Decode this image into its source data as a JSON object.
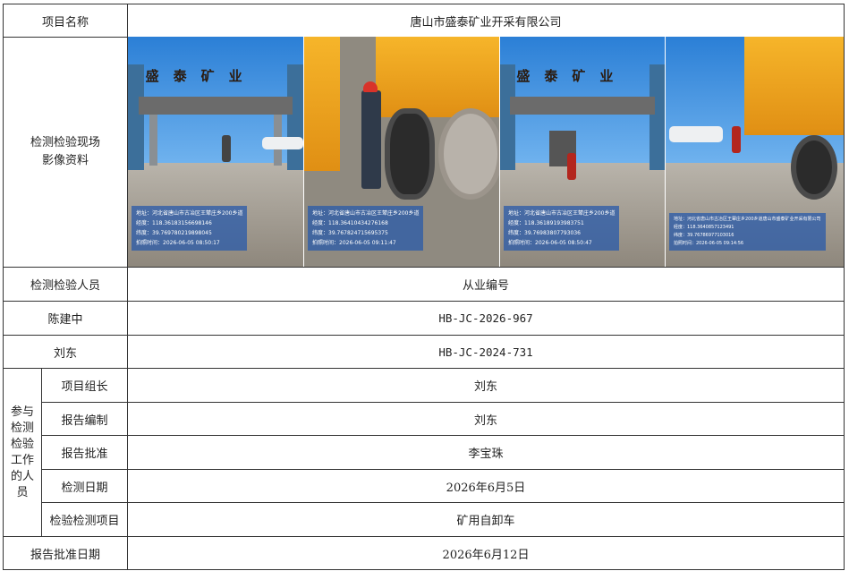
{
  "rows": {
    "project_name_label": "项目名称",
    "project_name_value": "唐山市盛泰矿业开采有限公司",
    "media_label_line1": "检测检验现场",
    "media_label_line2": "影像资料",
    "inspector_label": "检测检验人员",
    "cert_label": "从业编号",
    "inspector1_name": "陈建中",
    "inspector1_cert": "HB-JC-2026-967",
    "inspector2_name": "刘东",
    "inspector2_cert": "HB-JC-2024-731",
    "group_label": "参与检测检验工作的人员",
    "team_leader_label": "项目组长",
    "team_leader_value": "刘东",
    "report_writer_label": "报告编制",
    "report_writer_value": "刘东",
    "report_approver_label": "报告批准",
    "report_approver_value": "李宝珠",
    "test_date_label": "检测日期",
    "test_date_value": "2026年6月5日",
    "test_item_label": "检验检测项目",
    "test_item_value": "矿用自卸车",
    "approval_date_label": "报告批准日期",
    "approval_date_value": "2026年6月12日"
  },
  "photos": [
    {
      "sign": "盛泰矿业",
      "stamp": [
        "地址：河北省唐山市古冶区王辇庄乡200乡道",
        "经度：118.36183156698146",
        "纬度：39.769780219898045",
        "拍照时间：2026-06-05 08:50:17"
      ]
    },
    {
      "sign": "",
      "stamp": [
        "地址：河北省唐山市古冶区王辇庄乡200乡道",
        "经度：118.36410434276168",
        "纬度：39.767824715695375",
        "拍照时间：2026-06-05 09:11:47"
      ]
    },
    {
      "sign": "盛泰矿业",
      "stamp": [
        "地址：河北省唐山市古冶区王辇庄乡200乡道",
        "经度：118.36189193983751",
        "纬度：39.76983807793036",
        "拍照时间：2026-06-05 08:50:47"
      ]
    },
    {
      "sign": "",
      "stamp": [
        "地址：河北省唐山市古冶区王辇庄乡200乡道唐山市盛泰矿业开采有限公司",
        "经度：118.3640857123491",
        "纬度：39.76786977103016",
        "拍照时间：2026-06-05 09:14:56"
      ]
    }
  ]
}
